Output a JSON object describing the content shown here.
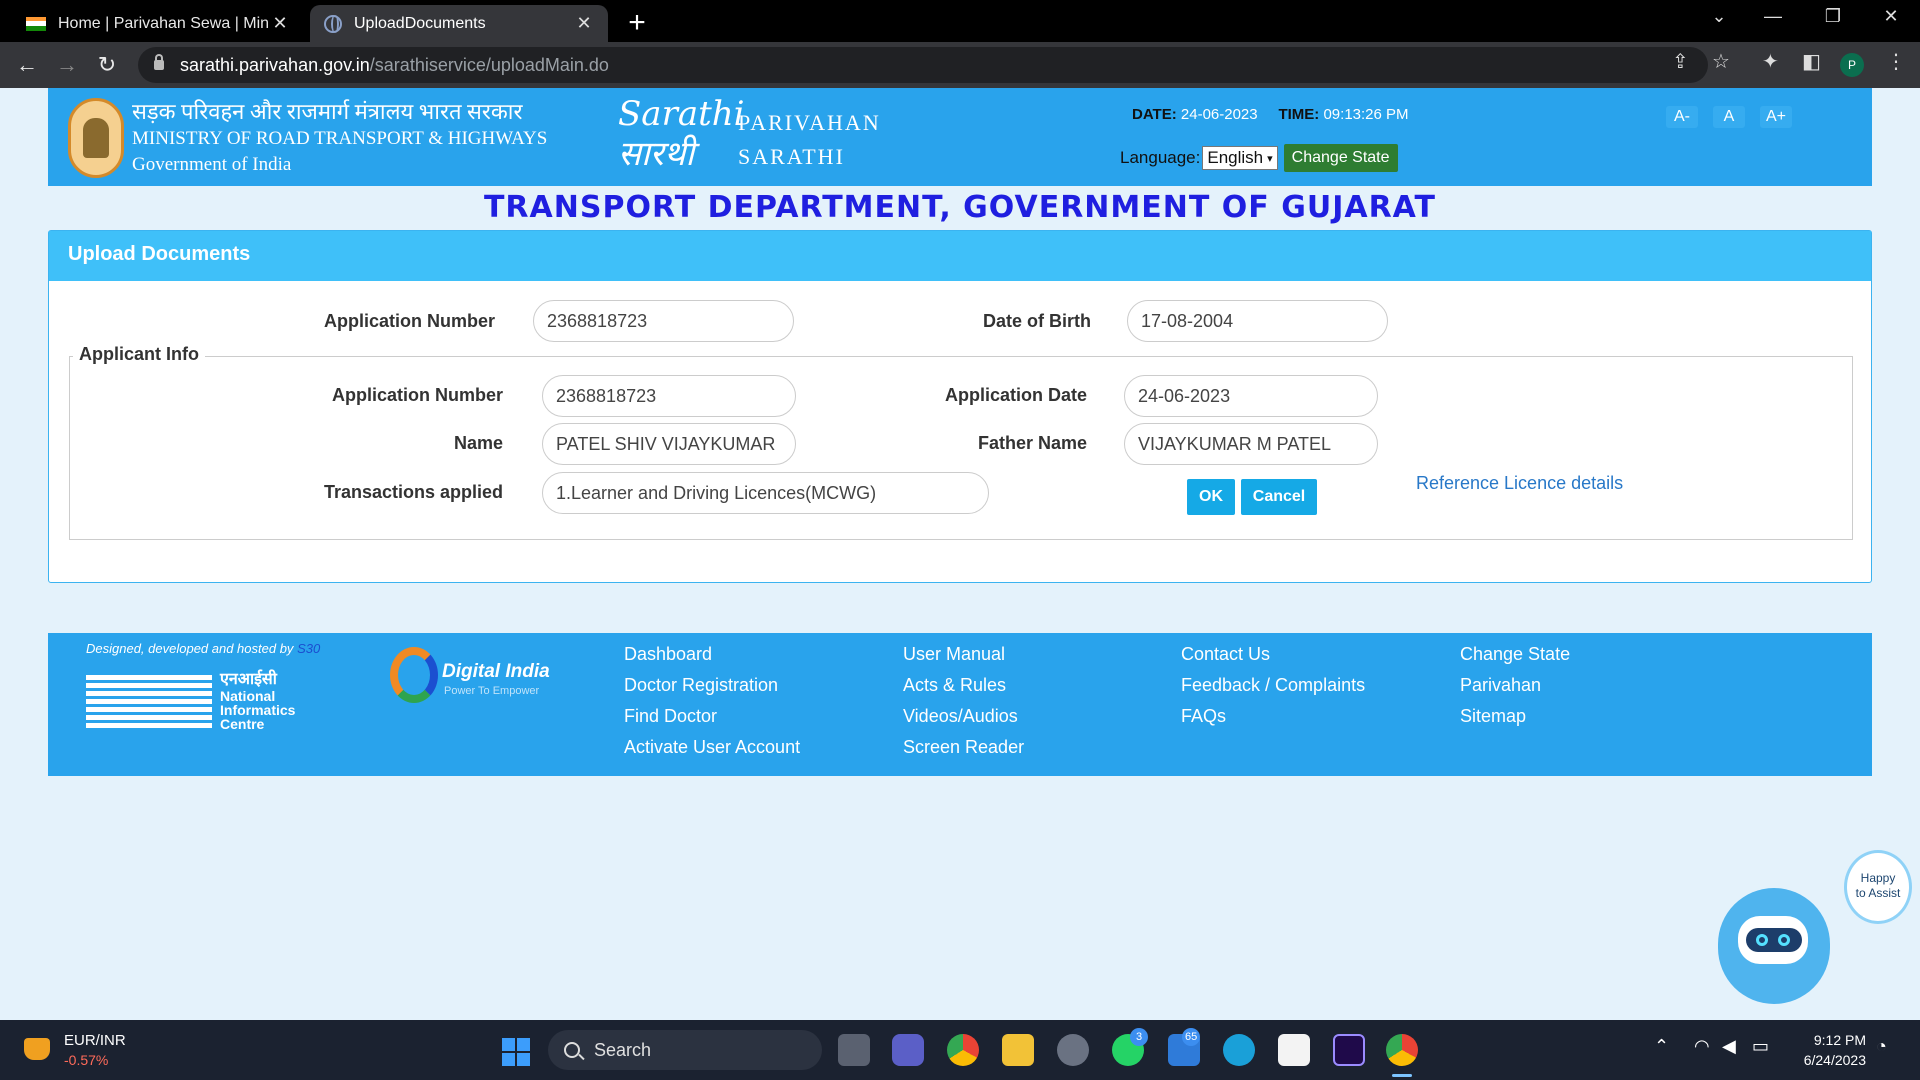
{
  "browser": {
    "tabs": [
      {
        "title": "Home | Parivahan Sewa | Ministry"
      },
      {
        "title": "UploadDocuments"
      }
    ],
    "url_host": "sarathi.parivahan.gov.in",
    "url_path": "/sarathiservice/uploadMain.do",
    "profile_initial": "P"
  },
  "header": {
    "ministry_hindi": "सड़क परिवहन और राजमार्ग मंत्रालय भारत सरकार",
    "ministry_english": "MINISTRY OF ROAD TRANSPORT & HIGHWAYS",
    "government": "Government of India",
    "logo_line1": "Sarathi",
    "logo_line2": "सारथी",
    "parivahan": "PARIVAHAN",
    "sarathi": "SARATHI",
    "date_label": "DATE:",
    "date_value": "24-06-2023",
    "time_label": "TIME:",
    "time_value": "09:13:26 PM",
    "language_label": "Language:",
    "language_selected": "English",
    "change_state": "Change State",
    "font_decrease": "A-",
    "font_normal": "A",
    "font_increase": "A+"
  },
  "dept_title": "TRANSPORT DEPARTMENT, GOVERNMENT OF GUJARAT",
  "panel": {
    "title": "Upload Documents",
    "search": {
      "app_number_label": "Application Number",
      "app_number_value": "2368818723",
      "dob_label": "Date of Birth",
      "dob_value": "17-08-2004"
    },
    "applicant": {
      "legend": "Applicant Info",
      "app_number_label": "Application Number",
      "app_number_value": "2368818723",
      "app_date_label": "Application Date",
      "app_date_value": "24-06-2023",
      "name_label": "Name",
      "name_value": "PATEL SHIV VIJAYKUMAR",
      "father_label": "Father Name",
      "father_value": "VIJAYKUMAR M PATEL",
      "transactions_label": "Transactions applied",
      "transactions_value": "1.Learner and Driving Licences(MCWG)",
      "ok": "OK",
      "cancel": "Cancel",
      "reference_link": "Reference Licence details"
    }
  },
  "footer": {
    "designed_by": "Designed, developed and hosted by",
    "designed_by_org": "S30",
    "nic_hindi": "एनआईसी",
    "nic_line1": "National",
    "nic_line2": "Informatics",
    "nic_line3": "Centre",
    "digital_india": "Digital India",
    "digital_india_tag": "Power To Empower",
    "links": {
      "col1": [
        "Dashboard",
        "Doctor Registration",
        "Find Doctor",
        "Activate User Account"
      ],
      "col2": [
        "User Manual",
        "Acts & Rules",
        "Videos/Audios",
        "Screen Reader"
      ],
      "col3": [
        "Contact Us",
        "Feedback / Complaints",
        "FAQs"
      ],
      "col4": [
        "Change State",
        "Parivahan",
        "Sitemap"
      ]
    }
  },
  "chatbot": {
    "bubble_line1": "Happy",
    "bubble_line2": "to Assist"
  },
  "taskbar": {
    "fx_name": "EUR/INR",
    "fx_change": "-0.57%",
    "search_placeholder": "Search",
    "whatsapp_badge": "3",
    "mail_badge": "65",
    "time": "9:12 PM",
    "date": "6/24/2023"
  },
  "colors": {
    "header_blue": "#29a3ec",
    "panel_head": "#3fc0f9",
    "title_blue": "#1f1fe0",
    "button_blue": "#15a9e6",
    "change_state_green": "#2e7d32"
  }
}
